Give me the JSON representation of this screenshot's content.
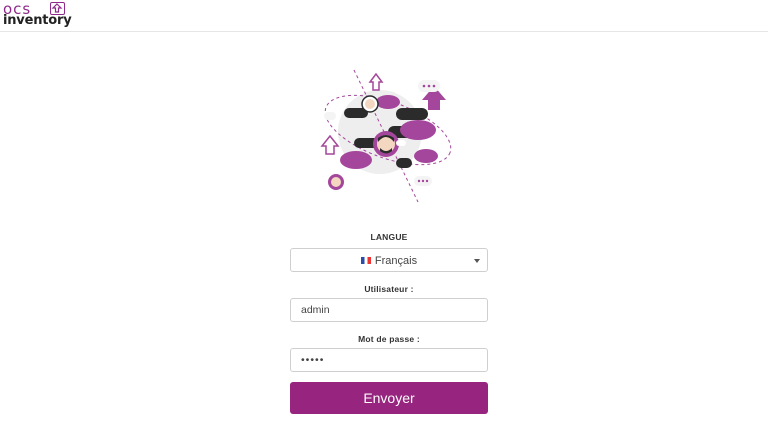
{
  "logo": {
    "top_text": "OCS",
    "bottom_text": "inventory",
    "brand_color": "#8e2a8b"
  },
  "illustration": {
    "icon": "people-cloud-network-illustration",
    "accent_color": "#a4479c"
  },
  "form": {
    "language_label": "LANGUE",
    "language_selected": "Français",
    "language_flag_icon": "flag-france-icon",
    "user_label": "Utilisateur :",
    "user_value": "admin",
    "password_label": "Mot de passe :",
    "password_value": "•••••",
    "submit_label": "Envoyer",
    "submit_color": "#97247f"
  }
}
